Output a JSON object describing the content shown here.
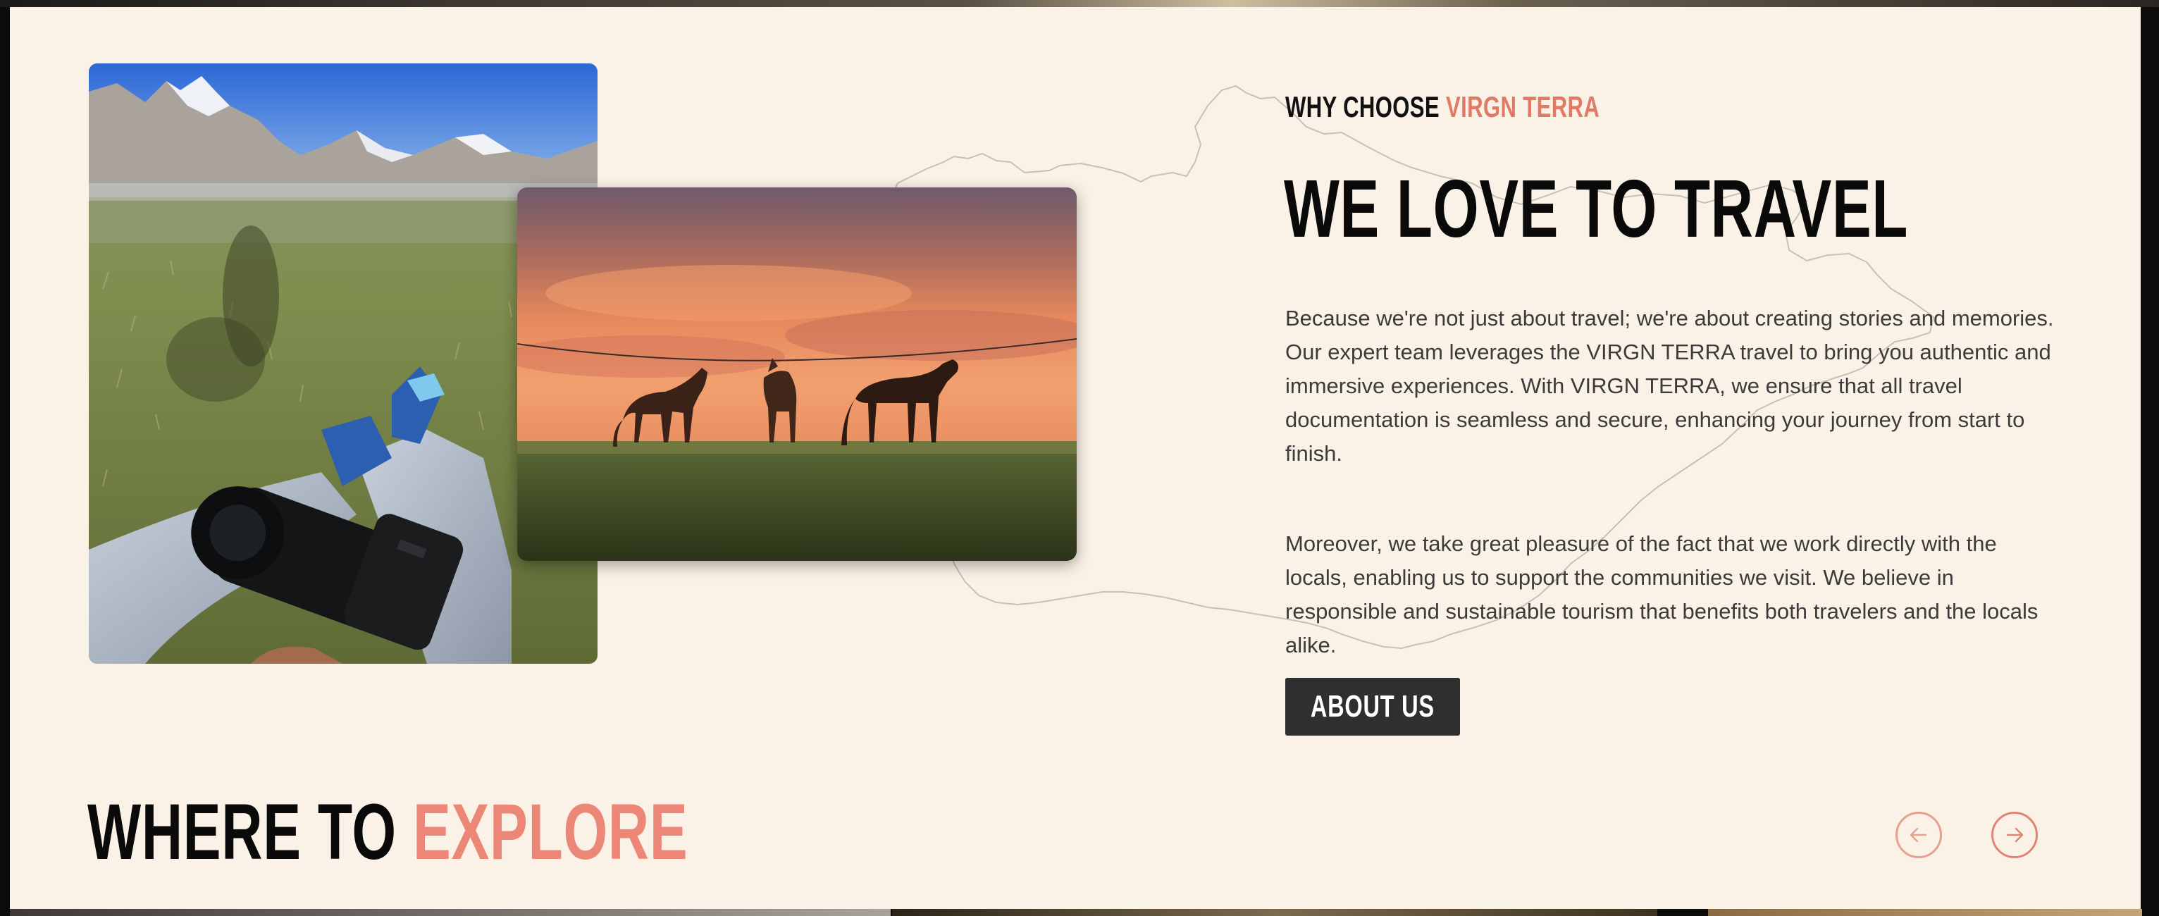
{
  "why": {
    "prefix": "WHY CHOOSE",
    "brand": "VIRGN TERRA"
  },
  "headline": "WE LOVE TO TRAVEL",
  "paragraphs": {
    "first": "Because we're not just about travel; we're about creating stories and memories. Our expert team leverages the VIRGN TERRA travel to bring you authentic and immersive experiences. With VIRGN TERRA, we ensure that all travel documentation is seamless and secure, enhancing your journey from start to finish.",
    "second": "Moreover, we take great pleasure of the fact that we work directly with the locals, enabling us to support the communities we visit. We believe in responsible and sustainable tourism that benefits both travelers and the locals alike."
  },
  "cta": {
    "about_label": "ABOUT US"
  },
  "explore": {
    "title_plain": "WHERE TO",
    "title_accent": "EXPLORE"
  },
  "icons": {
    "prev": "arrow-left-icon",
    "next": "arrow-right-icon"
  },
  "colors": {
    "background": "#fbf2e7",
    "accent": "#e07a67",
    "accent_light": "#ec8677",
    "button_bg": "#2f2f30",
    "text": "#3b3b3b"
  }
}
